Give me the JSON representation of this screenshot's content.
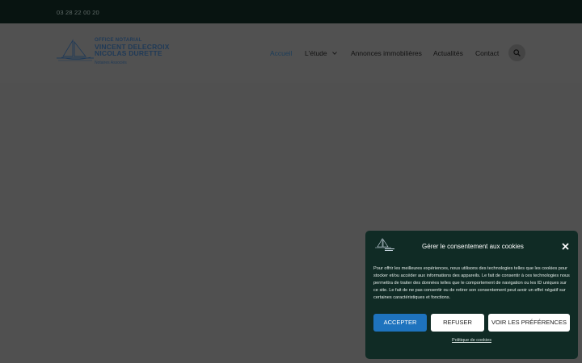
{
  "topbar": {
    "phone": "03 28 22 00 20"
  },
  "logo": {
    "line1": "OFFICE NOTARIAL",
    "line2": "VINCENT DELECROIX",
    "line3": "NICOLAS DURETTE",
    "line4": "Notaires Associés"
  },
  "nav": {
    "items": [
      {
        "label": "Accueil"
      },
      {
        "label": "L'étude"
      },
      {
        "label": "Annonces immobilières"
      },
      {
        "label": "Actualités"
      },
      {
        "label": "Contact"
      }
    ]
  },
  "cookie": {
    "title": "Gérer le consentement aux cookies",
    "text": "Pour offrir les meilleures expériences, nous utilisons des technologies telles que les cookies pour stocker et/ou accéder aux informations des appareils. Le fait de consentir à ces technologies nous permettra de traiter des données telles que le comportement de navigation ou les ID uniques sur ce site. Le fait de ne pas consentir ou de retirer son consentement peut avoir un effet négatif sur certaines caractéristiques et fonctions.",
    "accept": "ACCEPTER",
    "refuse": "REFUSER",
    "preferences": "VOIR LES PRÉFÉRENCES",
    "policy": "Politique de cookies"
  },
  "colors": {
    "accent": "#1e73be",
    "modal_bg": "#102b25",
    "topbar_bg": "#081411",
    "overlay": "#505050"
  }
}
